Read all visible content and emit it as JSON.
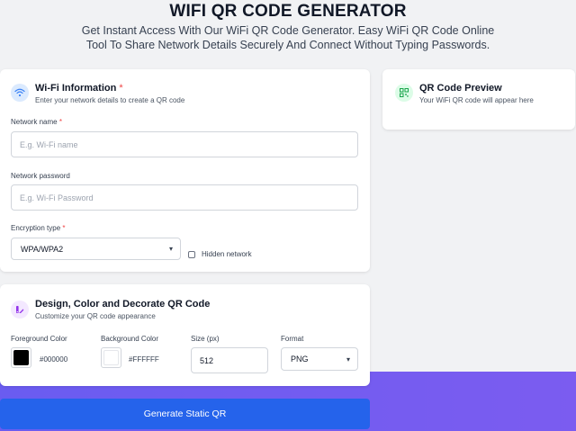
{
  "header": {
    "title": "WIFI QR CODE GENERATOR",
    "subtitle": "Get Instant Access With Our WiFi QR Code Generator. Easy WiFi QR Code Online Tool To Share Network Details Securely And Connect Without Typing Passwords."
  },
  "wifi_card": {
    "title": "Wi-Fi Information",
    "required_mark": "*",
    "subtitle": "Enter your network details to create a QR code",
    "network_name": {
      "label": "Network name",
      "required_mark": "*",
      "placeholder": "E.g. Wi-Fi name",
      "value": ""
    },
    "network_password": {
      "label": "Network password",
      "placeholder": "E.g. Wi-Fi Password",
      "value": ""
    },
    "encryption": {
      "label": "Encryption type",
      "required_mark": "*",
      "selected": "WPA/WPA2"
    },
    "hidden_network": {
      "label": "Hidden network",
      "checked": false
    }
  },
  "preview_card": {
    "title": "QR Code Preview",
    "subtitle": "Your WiFi QR code will appear here"
  },
  "design_card": {
    "title": "Design, Color and Decorate QR Code",
    "subtitle": "Customize your QR code appearance",
    "foreground": {
      "label": "Foreground Color",
      "value": "#000000"
    },
    "background": {
      "label": "Background Color",
      "value": "#FFFFFF"
    },
    "size": {
      "label": "Size (px)",
      "value": "512"
    },
    "format": {
      "label": "Format",
      "selected": "PNG"
    }
  },
  "generate_button": {
    "label": "Generate Static QR"
  },
  "icons": {
    "wifi": "wifi-icon",
    "qr": "qr-code-icon",
    "palette": "palette-icon",
    "chevron": "chevron-down-icon"
  },
  "colors": {
    "accent_blue": "#2563eb",
    "purple_band": "#6a5cf0",
    "required": "#ef4444"
  }
}
